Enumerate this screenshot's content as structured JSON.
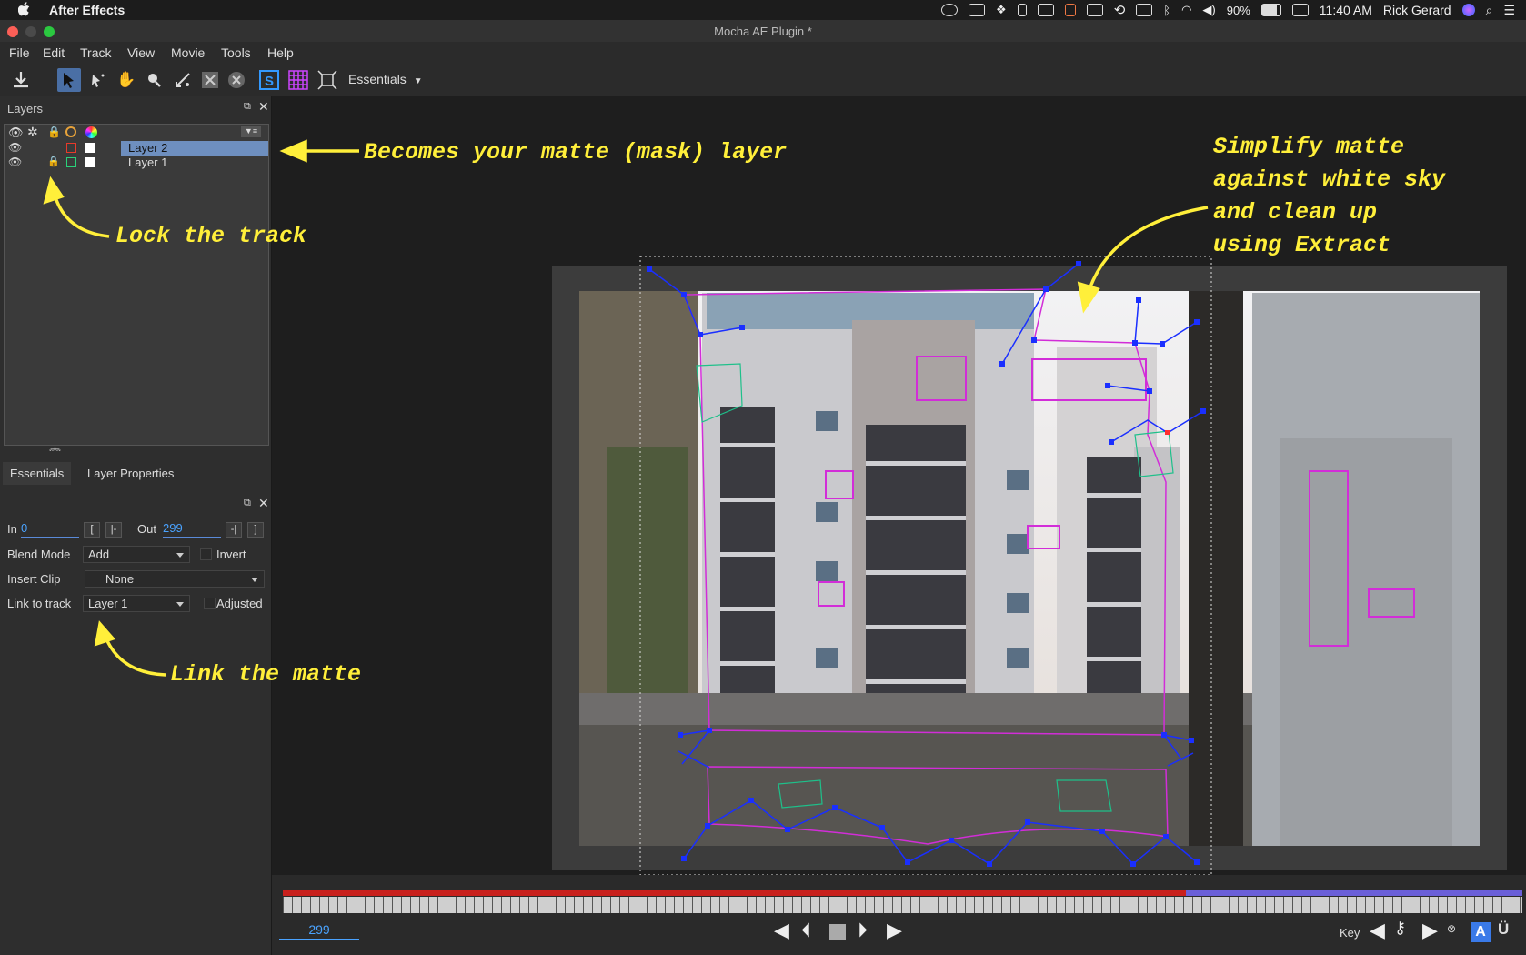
{
  "mac_menubar": {
    "app_name": "After Effects",
    "battery": "90%",
    "time": "11:40 AM",
    "user": "Rick Gerard"
  },
  "window": {
    "title": "Mocha AE Plugin *"
  },
  "menu": [
    "File",
    "Edit",
    "Track",
    "View",
    "Movie",
    "Tools",
    "Help"
  ],
  "toolbar": {
    "workspace": "Essentials"
  },
  "layers_panel": {
    "title": "Layers",
    "layers": [
      {
        "name": "Layer 2",
        "selected": true,
        "color": "#e83a2a"
      },
      {
        "name": "Layer 1",
        "selected": false,
        "color": "#2ad17a",
        "locked": true
      }
    ]
  },
  "essentials_panel": {
    "tabs": [
      "Essentials",
      "Layer Properties"
    ],
    "in_label": "In",
    "in_value": "0",
    "out_label": "Out",
    "out_value": "299",
    "blend_mode_label": "Blend Mode",
    "blend_mode_value": "Add",
    "invert_label": "Invert",
    "insert_clip_label": "Insert Clip",
    "insert_clip_value": "None",
    "link_to_track_label": "Link to track",
    "link_to_track_value": "Layer 1",
    "adjusted_label": "Adjusted"
  },
  "annotations": {
    "matte_layer": "Becomes your matte (mask) layer",
    "lock_track": "Lock the track",
    "link_matte": "Link the matte",
    "simplify_1": "Simplify matte",
    "simplify_2": "against white sky",
    "simplify_3": "and clean up",
    "simplify_4": "using Extract"
  },
  "timeline": {
    "current_frame": "299",
    "key_label": "Key"
  },
  "colors": {
    "annotation": "#ffef3a",
    "selection": "#6e8fbf",
    "spline_magenta": "#d22dd8",
    "spline_blue": "#1a2fff",
    "timeline_red": "#c8201c",
    "timeline_blue": "#6a5fd8"
  }
}
